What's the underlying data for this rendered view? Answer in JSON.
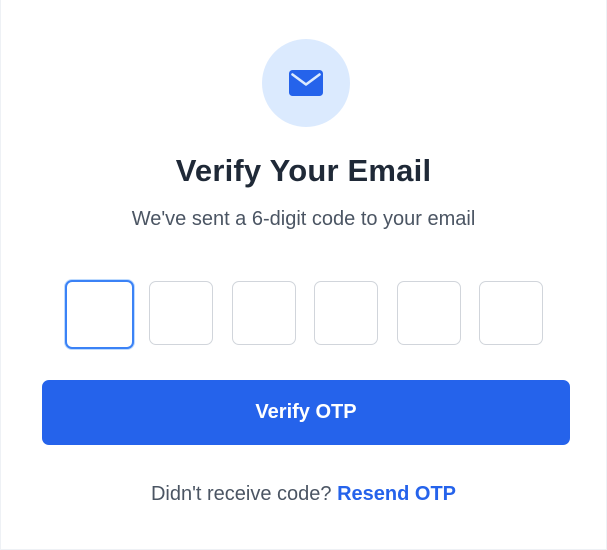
{
  "header": {
    "icon": "mail-icon",
    "title": "Verify Your Email",
    "subtitle": "We've sent a 6-digit code to your email"
  },
  "otp": {
    "digits": [
      "",
      "",
      "",
      "",
      "",
      ""
    ],
    "active_index": 0
  },
  "actions": {
    "verify_label": "Verify OTP"
  },
  "footer": {
    "prompt": "Didn't receive code?",
    "resend_label": "Resend OTP"
  },
  "colors": {
    "primary": "#2563eb",
    "icon_bg": "#dbeafe",
    "title": "#1f2937",
    "muted": "#4b5563",
    "focus_border": "#3b82f6",
    "box_border": "#d1d5db"
  }
}
